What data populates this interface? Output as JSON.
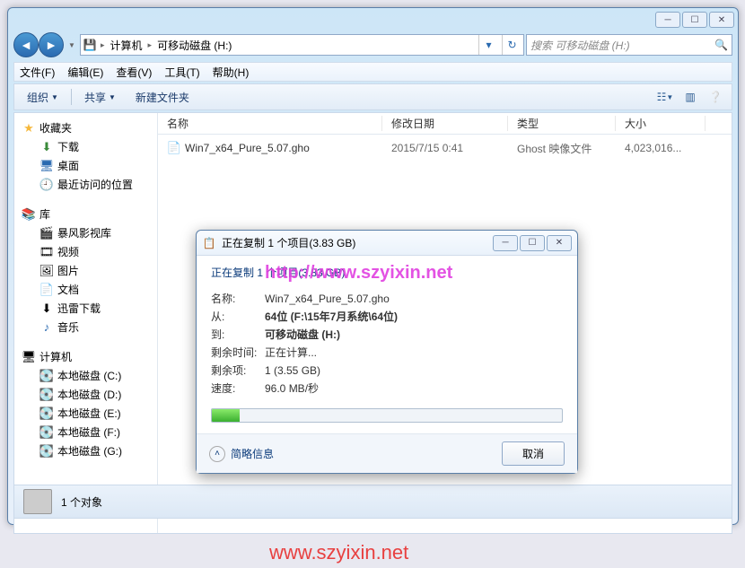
{
  "window": {
    "breadcrumb": {
      "computer": "计算机",
      "drive": "可移动磁盘 (H:)"
    },
    "search_placeholder": "搜索 可移动磁盘 (H:)"
  },
  "menubar": [
    "文件(F)",
    "编辑(E)",
    "查看(V)",
    "工具(T)",
    "帮助(H)"
  ],
  "toolbar": {
    "organize": "组织",
    "share": "共享",
    "new_folder": "新建文件夹"
  },
  "columns": {
    "name": "名称",
    "modified": "修改日期",
    "type": "类型",
    "size": "大小"
  },
  "sidebar": {
    "favorites": {
      "label": "收藏夹",
      "items": [
        "下载",
        "桌面",
        "最近访问的位置"
      ]
    },
    "libraries": {
      "label": "库",
      "items": [
        "暴风影视库",
        "视频",
        "图片",
        "文档",
        "迅雷下载",
        "音乐"
      ]
    },
    "computer": {
      "label": "计算机",
      "items": [
        "本地磁盘 (C:)",
        "本地磁盘 (D:)",
        "本地磁盘 (E:)",
        "本地磁盘 (F:)",
        "本地磁盘 (G:)"
      ]
    }
  },
  "files": [
    {
      "name": "Win7_x64_Pure_5.07.gho",
      "modified": "2015/7/15 0:41",
      "type": "Ghost 映像文件",
      "size": "4,023,016..."
    }
  ],
  "statusbar": {
    "count": "1 个对象"
  },
  "dialog": {
    "title": "正在复制 1 个项目(3.83 GB)",
    "heading": "正在复制 1 个项目(3.83 GB)",
    "labels": {
      "name": "名称:",
      "from": "从:",
      "to": "到:",
      "remaining_time": "剩余时间:",
      "remaining_items": "剩余项:",
      "speed": "速度:"
    },
    "values": {
      "name": "Win7_x64_Pure_5.07.gho",
      "from": "64位 (F:\\15年7月系统\\64位)",
      "to": "可移动磁盘 (H:)",
      "remaining_time": "正在计算...",
      "remaining_items": "1 (3.55 GB)",
      "speed": "96.0 MB/秒"
    },
    "simple_info": "简略信息",
    "cancel": "取消"
  },
  "watermarks": {
    "w1": "http://www.szyixin.net",
    "w2": "www.szyixin.net"
  }
}
